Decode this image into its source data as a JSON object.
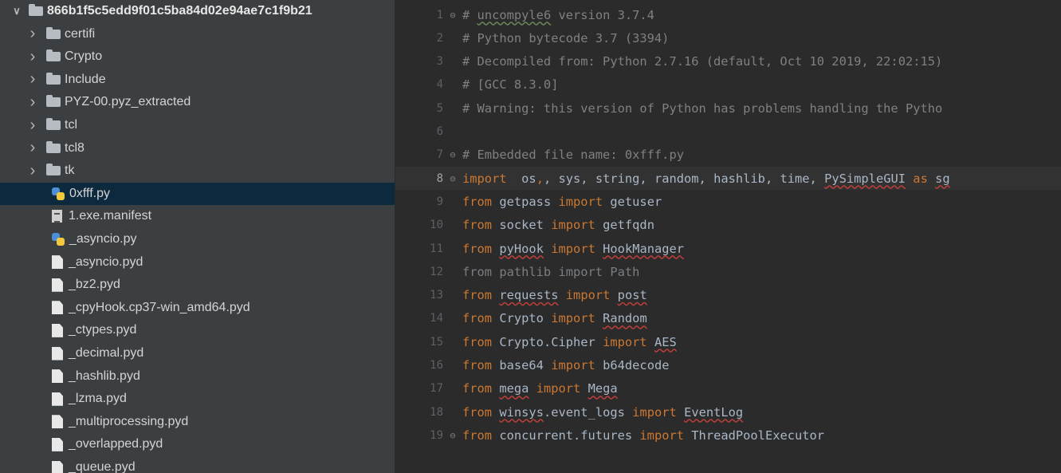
{
  "project_tree": {
    "root": "866b1f5c5edd9f01c5ba84d02e94ae7c1f9b21",
    "items": [
      {
        "label": "certifi",
        "kind": "folder"
      },
      {
        "label": "Crypto",
        "kind": "folder"
      },
      {
        "label": "Include",
        "kind": "folder"
      },
      {
        "label": "PYZ-00.pyz_extracted",
        "kind": "folder"
      },
      {
        "label": "tcl",
        "kind": "folder"
      },
      {
        "label": "tcl8",
        "kind": "folder"
      },
      {
        "label": "tk",
        "kind": "folder"
      },
      {
        "label": "0xfff.py",
        "kind": "python",
        "selected": true
      },
      {
        "label": "1.exe.manifest",
        "kind": "manifest"
      },
      {
        "label": "_asyncio.py",
        "kind": "python"
      },
      {
        "label": "_asyncio.pyd",
        "kind": "file"
      },
      {
        "label": "_bz2.pyd",
        "kind": "file"
      },
      {
        "label": "_cpyHook.cp37-win_amd64.pyd",
        "kind": "file"
      },
      {
        "label": "_ctypes.pyd",
        "kind": "file"
      },
      {
        "label": "_decimal.pyd",
        "kind": "file"
      },
      {
        "label": "_hashlib.pyd",
        "kind": "file"
      },
      {
        "label": "_lzma.pyd",
        "kind": "file"
      },
      {
        "label": "_multiprocessing.pyd",
        "kind": "file"
      },
      {
        "label": "_overlapped.pyd",
        "kind": "file"
      },
      {
        "label": "_queue.pyd",
        "kind": "file"
      }
    ]
  },
  "editor": {
    "current_line": 8,
    "lines": [
      {
        "n": "1",
        "fold": "open",
        "tokens": [
          [
            "cmt",
            "# "
          ],
          [
            "cmt typo",
            "uncompyle6"
          ],
          [
            "cmt",
            " version 3.7.4"
          ]
        ]
      },
      {
        "n": "2",
        "tokens": [
          [
            "cmt",
            "# Python bytecode 3.7 (3394)"
          ]
        ]
      },
      {
        "n": "3",
        "tokens": [
          [
            "cmt",
            "# Decompiled from: Python 2.7.16 (default, Oct 10 2019, 22:02:15)"
          ]
        ]
      },
      {
        "n": "4",
        "tokens": [
          [
            "cmt",
            "# [GCC 8.3.0]"
          ]
        ]
      },
      {
        "n": "5",
        "tokens": [
          [
            "cmt",
            "# Warning: this version of Python has problems handling the Pytho"
          ]
        ]
      },
      {
        "n": "6",
        "tokens": []
      },
      {
        "n": "7",
        "fold": "close",
        "tokens": [
          [
            "cmt",
            "# Embedded file name: 0xfff.py"
          ]
        ]
      },
      {
        "n": "8",
        "fold": "open",
        "tokens": [
          [
            "kw",
            "import"
          ],
          [
            "",
            "  os"
          ],
          [
            "kw",
            ","
          ],
          [
            "",
            ", sys, string, random, hashlib, time, "
          ],
          [
            "err",
            "PySimpleGUI"
          ],
          [
            "",
            " "
          ],
          [
            "kw",
            "as"
          ],
          [
            "",
            " "
          ],
          [
            "err",
            "sg"
          ]
        ]
      },
      {
        "n": "9",
        "tokens": [
          [
            "kw",
            "from"
          ],
          [
            "",
            " getpass "
          ],
          [
            "kw",
            "import"
          ],
          [
            "",
            " getuser"
          ]
        ]
      },
      {
        "n": "10",
        "tokens": [
          [
            "kw",
            "from"
          ],
          [
            "",
            " socket "
          ],
          [
            "kw",
            "import"
          ],
          [
            "",
            " getfqdn"
          ]
        ]
      },
      {
        "n": "11",
        "tokens": [
          [
            "kw",
            "from"
          ],
          [
            "",
            " "
          ],
          [
            "err",
            "pyHook"
          ],
          [
            "",
            " "
          ],
          [
            "kw",
            "import"
          ],
          [
            "",
            " "
          ],
          [
            "err",
            "HookManager"
          ]
        ]
      },
      {
        "n": "12",
        "tokens": [
          [
            "dim",
            "from pathlib import Path"
          ]
        ]
      },
      {
        "n": "13",
        "tokens": [
          [
            "kw",
            "from"
          ],
          [
            "",
            " "
          ],
          [
            "err",
            "requests"
          ],
          [
            "",
            " "
          ],
          [
            "kw",
            "import"
          ],
          [
            "",
            " "
          ],
          [
            "err",
            "post"
          ]
        ]
      },
      {
        "n": "14",
        "tokens": [
          [
            "kw",
            "from"
          ],
          [
            "",
            " Crypto "
          ],
          [
            "kw",
            "import"
          ],
          [
            "",
            " "
          ],
          [
            "err",
            "Random"
          ]
        ]
      },
      {
        "n": "15",
        "tokens": [
          [
            "kw",
            "from"
          ],
          [
            "",
            " Crypto.Cipher "
          ],
          [
            "kw",
            "import"
          ],
          [
            "",
            " "
          ],
          [
            "err",
            "AES"
          ]
        ]
      },
      {
        "n": "16",
        "tokens": [
          [
            "kw",
            "from"
          ],
          [
            "",
            " base64 "
          ],
          [
            "kw",
            "import"
          ],
          [
            "",
            " b64decode"
          ]
        ]
      },
      {
        "n": "17",
        "tokens": [
          [
            "kw",
            "from"
          ],
          [
            "",
            " "
          ],
          [
            "err",
            "mega"
          ],
          [
            "",
            " "
          ],
          [
            "kw",
            "import"
          ],
          [
            "",
            " "
          ],
          [
            "err",
            "Mega"
          ]
        ]
      },
      {
        "n": "18",
        "tokens": [
          [
            "kw",
            "from"
          ],
          [
            "",
            " "
          ],
          [
            "err",
            "winsys"
          ],
          [
            "",
            ".event_logs "
          ],
          [
            "kw",
            "import"
          ],
          [
            "",
            " "
          ],
          [
            "err",
            "EventLog"
          ]
        ]
      },
      {
        "n": "19",
        "fold": "close",
        "tokens": [
          [
            "kw",
            "from"
          ],
          [
            "",
            " concurrent.futures "
          ],
          [
            "kw",
            "import"
          ],
          [
            "",
            " ThreadPoolExecutor"
          ]
        ]
      }
    ]
  }
}
